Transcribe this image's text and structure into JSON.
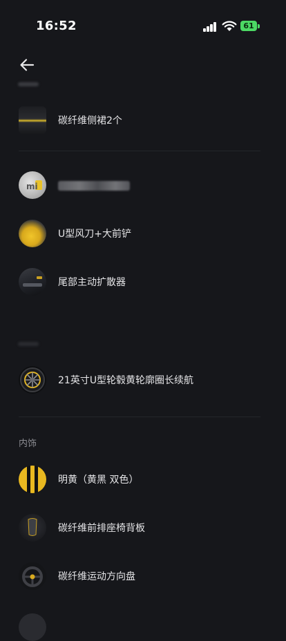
{
  "status": {
    "time": "16:52",
    "battery": "61"
  },
  "items": [
    {
      "label": "碳纤维侧裙2个",
      "icon": "side-skirt-thumb"
    },
    {
      "label": "",
      "icon": "xiaomi-badge-thumb"
    },
    {
      "label": "U型风刀+大前铲",
      "icon": "front-splitter-thumb"
    },
    {
      "label": "尾部主动扩散器",
      "icon": "rear-diffuser-thumb"
    },
    {
      "label": "21英寸U型轮毂黄轮廓圈长续航",
      "icon": "wheel-thumb"
    }
  ],
  "section": {
    "interior": "内饰"
  },
  "interior_items": [
    {
      "label": "明黄（黄黑 双色）",
      "icon": "yellow-black-swatch-thumb"
    },
    {
      "label": "碳纤维前排座椅背板",
      "icon": "seat-back-thumb"
    },
    {
      "label": "碳纤维运动方向盘",
      "icon": "steering-wheel-thumb"
    }
  ],
  "colors": {
    "background": "#16171b",
    "accent_yellow": "#e8b820",
    "battery_green": "#4cd964"
  }
}
